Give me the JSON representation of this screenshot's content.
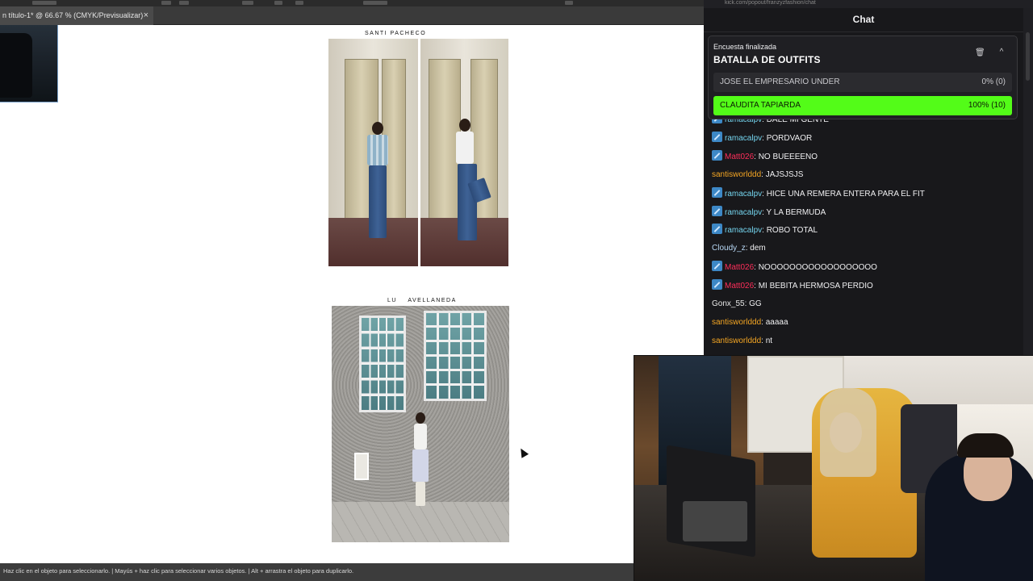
{
  "editor": {
    "doc_tab": "n título-1* @ 66.67 % (CMYK/Previsualizar)",
    "doc_tab_close": "×",
    "status": "Haz clic en el objeto para seleccionarlo.  |  Mayús + haz clic para seleccionar varios objetos.  |  Alt + arrastra el objeto para duplicarlo.",
    "photos": [
      {
        "caption": "SANTI PACHECO"
      },
      {
        "caption": "LU    AVELLANEDA"
      }
    ]
  },
  "chat": {
    "url": "kick.com/popout/franzyzfashion/chat",
    "title": "Chat",
    "poll": {
      "status": "Encuesta finalizada",
      "title": "BATALLA DE OUTFITS",
      "trash_icon": "🗑",
      "collapse_icon": "^",
      "options": [
        {
          "name": "JOSE EL EMPRESARIO UNDER",
          "result": "0% (0)"
        },
        {
          "name": "CLAUDITA TAPIARDA",
          "result": "100% (10)"
        }
      ]
    },
    "messages": [
      {
        "badge": true,
        "user": "ramacalpv",
        "color": "cyan",
        "text": "DALE MI GENTE"
      },
      {
        "badge": true,
        "user": "ramacalpv",
        "color": "cyan",
        "text": "PORDVAOR"
      },
      {
        "badge": true,
        "user": "Matt026",
        "color": "red",
        "text": "NO BUEEEENO"
      },
      {
        "badge": false,
        "user": "santisworlddd",
        "color": "orange",
        "text": "JAJSJSJS"
      },
      {
        "badge": true,
        "user": "ramacalpv",
        "color": "cyan",
        "text": "HICE UNA REMERA ENTERA PARA EL FIT"
      },
      {
        "badge": true,
        "user": "ramacalpv",
        "color": "cyan",
        "text": "Y LA BERMUDA"
      },
      {
        "badge": true,
        "user": "ramacalpv",
        "color": "cyan",
        "text": "ROBO TOTAL"
      },
      {
        "badge": false,
        "user": "Cloudy_z",
        "color": "light",
        "text": "dem"
      },
      {
        "badge": true,
        "user": "Matt026",
        "color": "red",
        "text": "NOOOOOOOOOOOOOOOOOO"
      },
      {
        "badge": true,
        "user": "Matt026",
        "color": "red",
        "text": "MI BEBITA HERMOSA PERDIO"
      },
      {
        "badge": false,
        "user": "Gonx_55",
        "color": "white",
        "text": "GG"
      },
      {
        "badge": false,
        "user": "santisworlddd",
        "color": "orange",
        "text": "aaaaa"
      },
      {
        "badge": false,
        "user": "santisworlddd",
        "color": "orange",
        "text": "nt"
      }
    ],
    "colors": {
      "cyan": "#74d4ee",
      "red": "#ff2e5a",
      "orange": "#f5a623",
      "light": "#b8d8f5",
      "white": "#e8e8e8",
      "poll_green": "#53fc18"
    }
  }
}
